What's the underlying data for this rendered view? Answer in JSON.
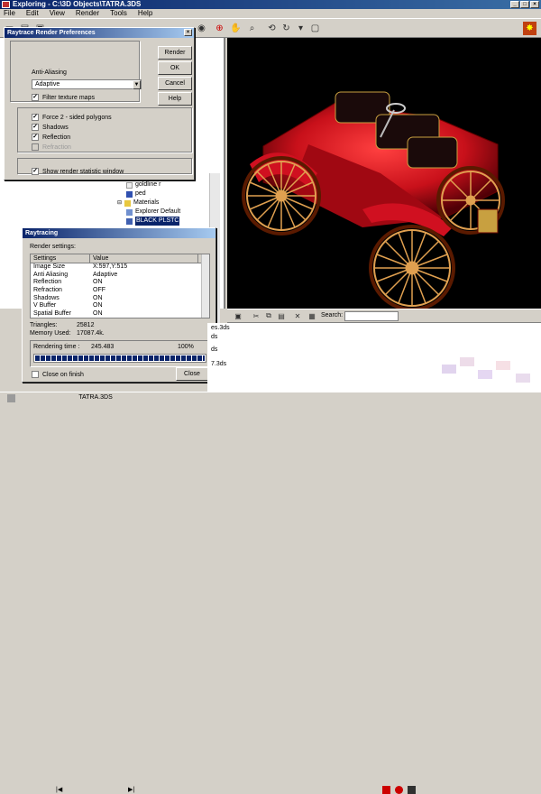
{
  "window": {
    "title": "Exploring - C:\\3D Objects\\TATRA.3DS"
  },
  "menu": [
    "File",
    "Edit",
    "View",
    "Render",
    "Tools",
    "Help"
  ],
  "raytrace_prefs": {
    "title": "Raytrace Render Preferences",
    "antialias_label": "Anti-Aliasing",
    "antialias_value": "Adaptive",
    "filter_texture": "Filter texture maps",
    "force_2sided": "Force 2 - sided polygons",
    "shadows": "Shadows",
    "reflection": "Reflection",
    "refraction": "Refraction",
    "show_stats": "Show render statistic window",
    "buttons": {
      "render": "Render",
      "ok": "OK",
      "cancel": "Cancel",
      "help": "Help"
    },
    "checked": {
      "filter_texture": true,
      "force_2sided": true,
      "shadows": true,
      "reflection": true,
      "refraction": false,
      "show_stats": true
    }
  },
  "raytracing": {
    "title": "Raytracing",
    "render_settings_label": "Render settings:",
    "columns": [
      "Settings",
      "Value"
    ],
    "rows": [
      [
        "Image Size",
        "X:597,Y:515"
      ],
      [
        "Anti Aliasing",
        "Adaptive"
      ],
      [
        "Reflection",
        "ON"
      ],
      [
        "Refraction",
        "OFF"
      ],
      [
        "Shadows",
        "ON"
      ],
      [
        "V Buffer",
        "ON"
      ],
      [
        "Spatial Buffer",
        "ON"
      ]
    ],
    "triangles_label": "Triangles:",
    "triangles_value": "25812",
    "memory_label": "Memory Used:",
    "memory_value": "17087.4k.",
    "render_time_label": "Rendering time :",
    "render_time_value": "245.483",
    "percent": "100%",
    "progress": 1.0,
    "close_on_finish": "Close on finish",
    "close_button": "Close"
  },
  "tree": {
    "items": [
      {
        "label": "goldline r",
        "color": "#f0f0f0"
      },
      {
        "label": "ped",
        "color": "#3050b0"
      },
      {
        "label": "Materials",
        "color": "#e8c840"
      },
      {
        "label": "Explorer Default",
        "color": "#7090d0"
      },
      {
        "label": "BLACK PLSTC",
        "color": "#4060b0"
      }
    ]
  },
  "bottom": {
    "search_label": "Search:",
    "files": [
      "es.3ds",
      "ds",
      "ds",
      "7.3ds"
    ]
  },
  "status": {
    "path": "TATRA.3DS"
  },
  "colors": {
    "accent": "#0a246a",
    "car_body": "#c8101a",
    "wheel": "#e0a050"
  }
}
